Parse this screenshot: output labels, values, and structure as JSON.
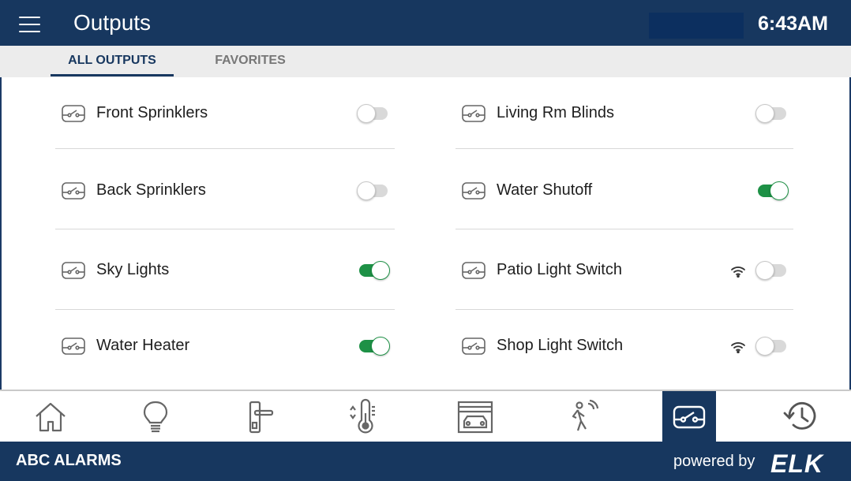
{
  "header": {
    "menu_icon": "hamburger-menu-icon",
    "title": "Outputs",
    "time": "6:43AM"
  },
  "tabs": [
    {
      "label": "ALL OUTPUTS",
      "active": true
    },
    {
      "label": "FAVORITES",
      "active": false
    }
  ],
  "outputs": {
    "left": [
      {
        "name": "Front Sprinklers",
        "on": false,
        "wireless": false
      },
      {
        "name": "Back Sprinklers",
        "on": false,
        "wireless": false
      },
      {
        "name": "Sky Lights",
        "on": true,
        "wireless": false
      },
      {
        "name": "Water Heater",
        "on": true,
        "wireless": false
      }
    ],
    "right": [
      {
        "name": "Living Rm Blinds",
        "on": false,
        "wireless": false
      },
      {
        "name": "Water Shutoff",
        "on": true,
        "wireless": false
      },
      {
        "name": "Patio Light Switch",
        "on": false,
        "wireless": true
      },
      {
        "name": "Shop Light Switch",
        "on": false,
        "wireless": true
      }
    ]
  },
  "nav": {
    "items": [
      "home-icon",
      "lightbulb-icon",
      "door-lock-icon",
      "thermostat-icon",
      "garage-icon",
      "motion-sensor-icon",
      "outputs-switch-icon",
      "history-icon"
    ],
    "active": "outputs-switch-icon"
  },
  "footer": {
    "brand": "ABC ALARMS",
    "powered_by": "powered by",
    "logo": "ELK"
  },
  "colors": {
    "primary": "#17375f",
    "toggle_on": "#1e9146",
    "toggle_off": "#d9d9d9",
    "tab_bar": "#ececec"
  }
}
